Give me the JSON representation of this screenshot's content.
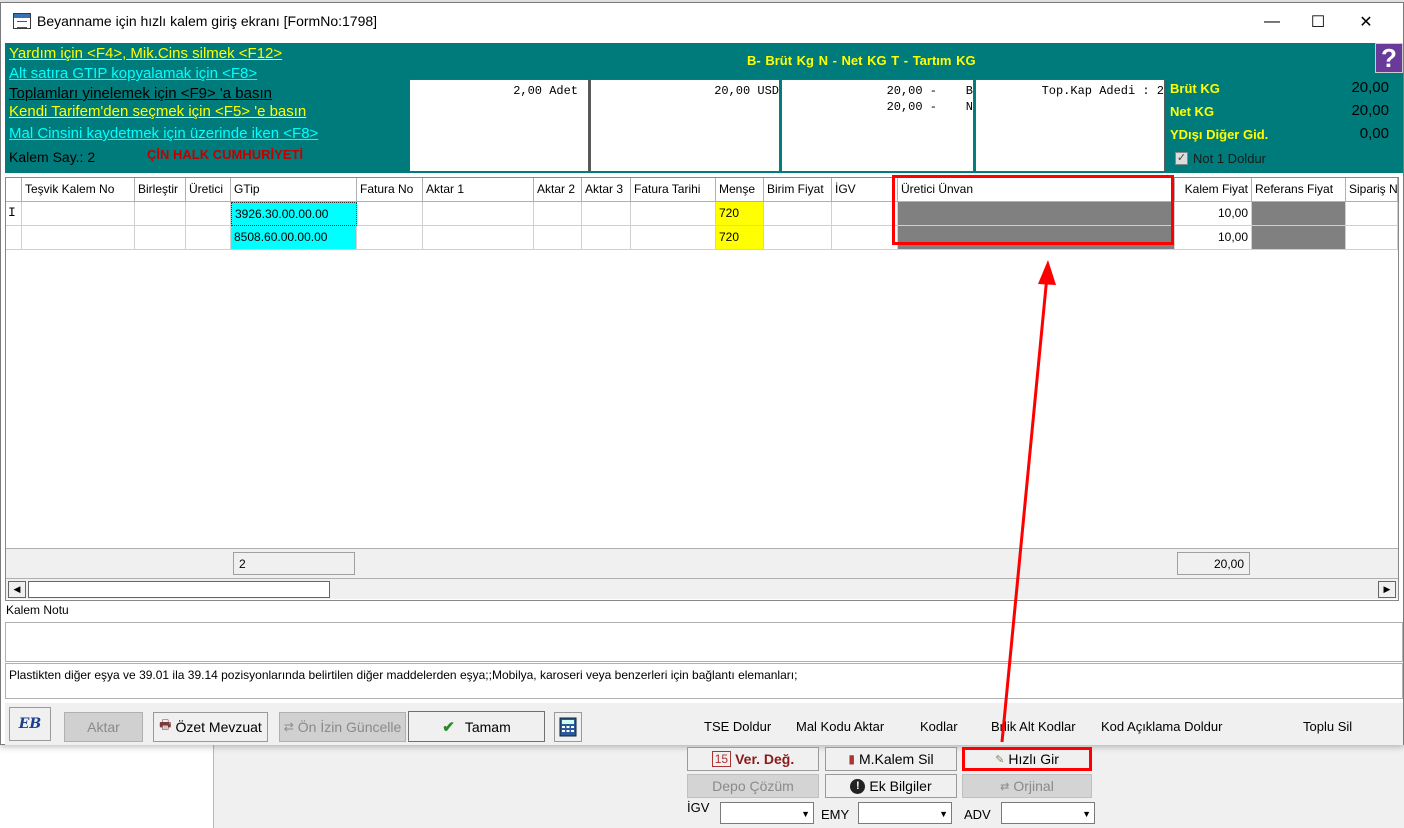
{
  "window": {
    "title": "Beyanname için hızlı kalem giriş ekranı [FormNo:1798]",
    "min": "—",
    "max": "☐",
    "close": "✕"
  },
  "header": {
    "help_line1": "Yardım için <F4>, Mik.Cins silmek <F12>",
    "help_line2": "Alt satıra GTIP kopyalamak için <F8>",
    "help_line3": "Toplamları yinelemek için <F9> 'a basın",
    "help_line4": "Kendi Tarifem'den seçmek  için <F5> 'e basın",
    "help_line5": "Mal Cinsini kaydetmek için üzerinde iken <F8>",
    "kalem_say": "Kalem Say.: 2",
    "country": "ÇİN HALK CUMHURİYETİ",
    "legend": "B- Brüt Kg    N - Net KG    T - Tartım KG",
    "box1": "2,00 Adet",
    "box2": "20,00 USD",
    "box3_line1": "20,00 -    B",
    "box3_line2": "20,00 -    N",
    "box4": "Top.Kap Adedi : 2",
    "brut_label": "Brüt KG",
    "brut_value": "20,00",
    "net_label": "Net KG",
    "net_value": "20,00",
    "ydisi_label": "YDışı Diğer Gid.",
    "ydisi_value": "0,00",
    "not1_label": "Not 1 Doldur",
    "help_icon": "?"
  },
  "grid": {
    "columns": [
      "Teşvik Kalem No",
      "Birleştir",
      "Üretici",
      "GTip",
      "Fatura No",
      "Aktar 1",
      "Aktar 2",
      "Aktar 3",
      "Fatura Tarihi",
      "Menşe",
      "Birim Fiyat",
      "İGV",
      "Üretici Ünvan",
      "Kalem Fiyat",
      "Referans Fiyat",
      "Sipariş No"
    ],
    "rows": [
      {
        "indicator": "I",
        "gtip": "3926.30.00.00.00",
        "mense": "720",
        "kalem_fiyat": "10,00"
      },
      {
        "indicator": "",
        "gtip": "8508.60.00.00.00",
        "mense": "720",
        "kalem_fiyat": "10,00"
      }
    ],
    "footer_count": "2",
    "footer_total": "20,00"
  },
  "note": {
    "label": "Kalem Notu",
    "description": "Plastikten diğer eşya ve 39.01 ila 39.14 pozisyonlarında belirtilen diğer maddelerden eşya;;Mobilya, karoseri veya benzerleri için bağlantı elemanları;"
  },
  "toolbar": {
    "logo": "EB",
    "aktar": "Aktar",
    "ozet_mevzuat": "Özet Mevzuat",
    "on_izin_guncelle": "Ön İzin Güncelle",
    "tamam": "Tamam",
    "tse_doldur": "TSE Doldur",
    "mal_kodu_aktar": "Mal Kodu Aktar",
    "kodlar": "Kodlar",
    "birlik_alt_kodlar": "Brlik Alt Kodlar",
    "kod_aciklama_doldur": "Kod Açıklama Doldur",
    "toplu_sil": "Toplu Sil"
  },
  "lower": {
    "ver_deg": "Ver. Değ.",
    "m_kalem_sil": "M.Kalem Sil",
    "hizli_gir": "Hızlı Gir",
    "depo_cozum": "Depo Çözüm",
    "ek_bilgiler": "Ek Bilgiler",
    "orjinal": "Orjinal",
    "igv_label": "İGV",
    "emy_label": "EMY",
    "adv_label": "ADV"
  },
  "colors": {
    "teal": "#007b7b",
    "highlight_yellow": "#ffff00",
    "highlight_cyan": "#00ffff",
    "annotation_red": "#ff0000"
  }
}
